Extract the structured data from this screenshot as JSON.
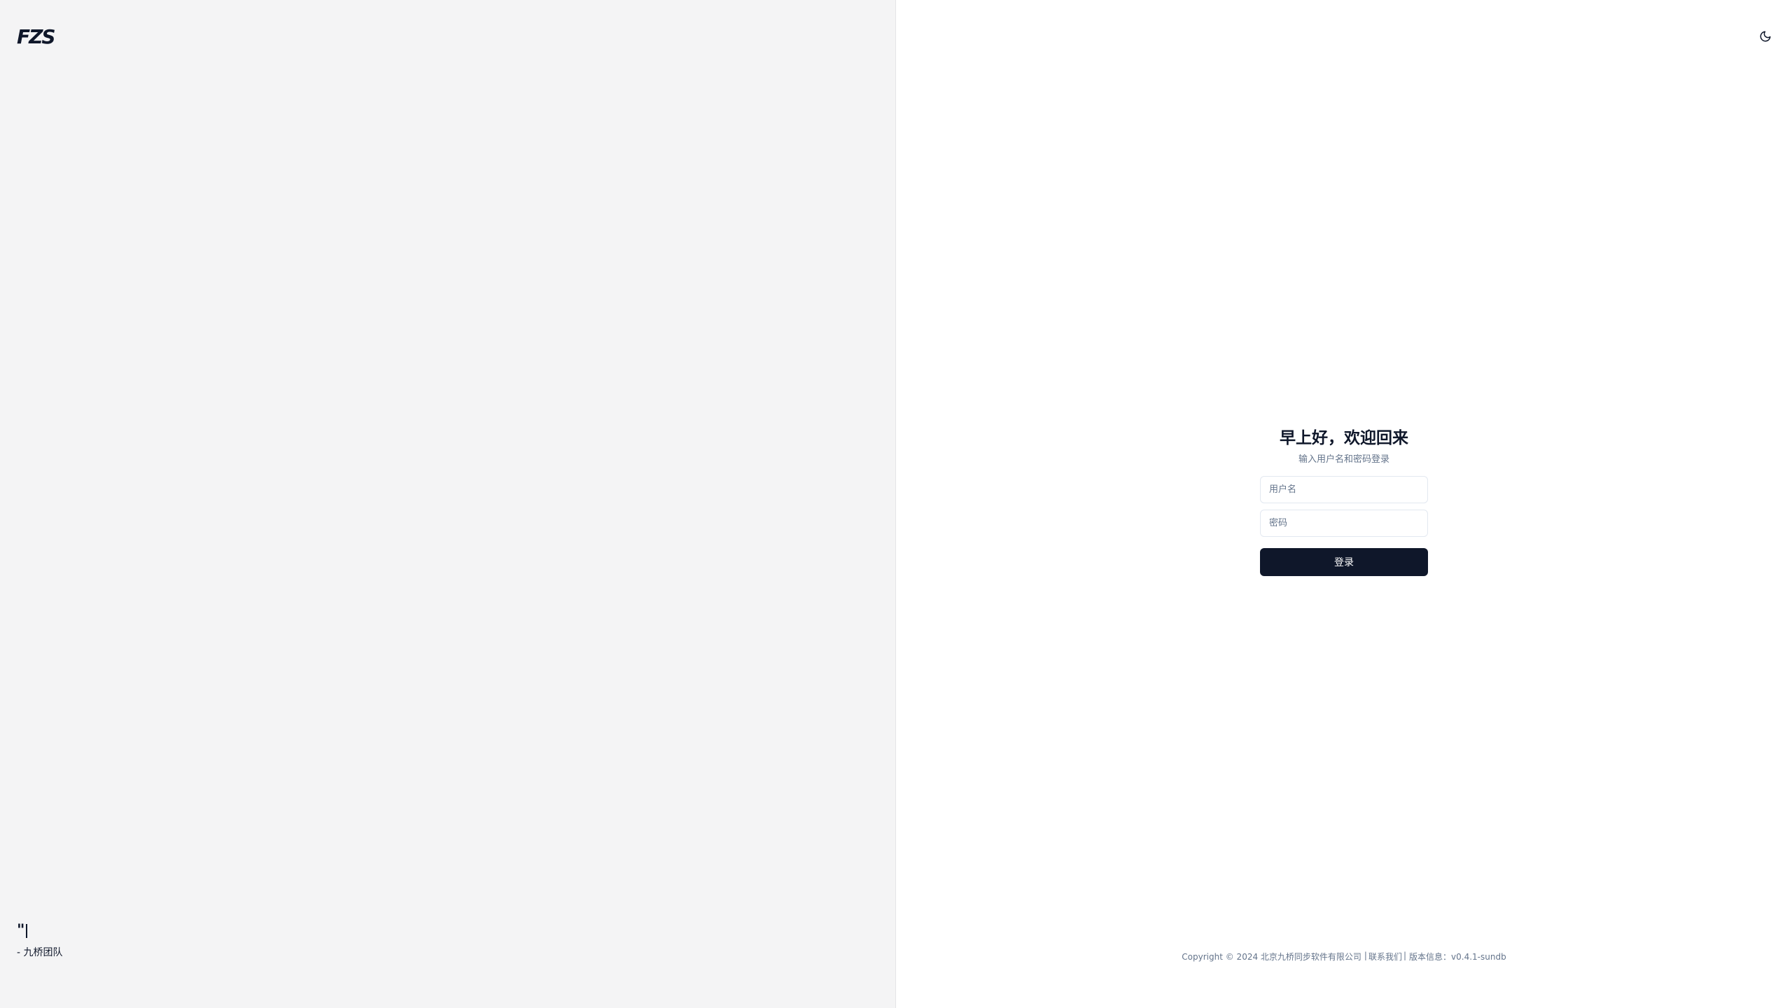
{
  "brand": {
    "logo_text": "FZS"
  },
  "quote": {
    "text": "\"",
    "author": "- 九桥团队"
  },
  "theme_toggle": {
    "icon": "moon-icon"
  },
  "login": {
    "title": "早上好，欢迎回来",
    "subtitle": "输入用户名和密码登录",
    "username_placeholder": "用户名",
    "password_placeholder": "密码",
    "submit_label": "登录"
  },
  "footer": {
    "copyright": "Copyright © 2024 北京九桥同步软件有限公司",
    "separator": "|",
    "contact_label": "联系我们",
    "version_label": "版本信息：v0.4.1-sundb"
  },
  "colors": {
    "left_panel_bg": "#f4f4f5",
    "primary": "#0f172a",
    "muted_text": "#64748b",
    "border": "#e2e8f0"
  }
}
